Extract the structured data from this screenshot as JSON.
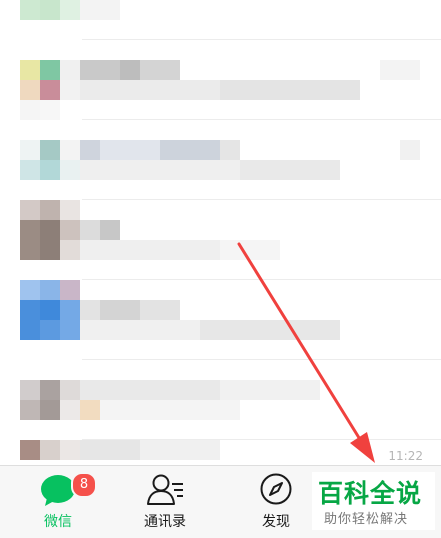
{
  "chat_list": {
    "last_time": "11:22"
  },
  "tabbar": {
    "chats_label": "微信",
    "chats_badge": "8",
    "contacts_label": "通讯录",
    "discover_label": "发现"
  },
  "watermark": {
    "title": "百科全说",
    "subtitle": "助你轻松解决"
  },
  "colors": {
    "accent": "#07c160",
    "badge": "#f5514b",
    "annotation_arrow": "#f0413e"
  },
  "icons": [
    "chat-bubble-icon",
    "contacts-icon",
    "compass-icon"
  ]
}
